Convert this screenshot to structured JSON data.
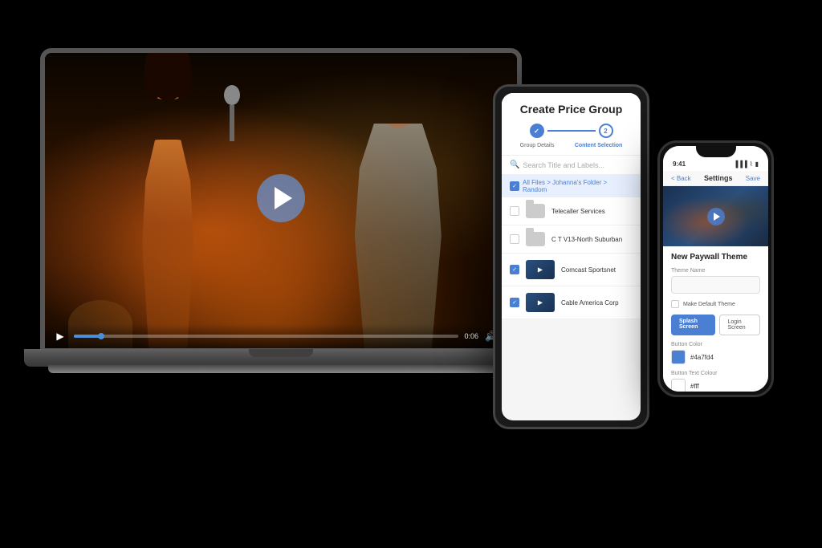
{
  "background": "#000000",
  "laptop": {
    "video": {
      "progress_percent": 8,
      "time_display": "0:06",
      "total_time": "0:06"
    }
  },
  "tablet": {
    "title": "Create Price Group",
    "steps": [
      {
        "number": "1",
        "label": "Group Details",
        "active": false
      },
      {
        "number": "2",
        "label": "Content Selection",
        "active": true
      }
    ],
    "search_placeholder": "Search Title and Labels...",
    "breadcrumb": "All Files > Johanna's Folder > Random",
    "files": [
      {
        "name": "Telecaller Services",
        "type": "folder",
        "checked": false
      },
      {
        "name": "C T V13-North Suburban",
        "type": "folder",
        "checked": false
      },
      {
        "name": "Comcast Sportsnet",
        "type": "video",
        "checked": true
      },
      {
        "name": "Cable America Corp",
        "type": "video",
        "checked": true
      }
    ]
  },
  "phone": {
    "status_time": "9:41",
    "status_icons": "●●●",
    "header_back": "< Back",
    "header_title": "Settings",
    "header_save": "Save",
    "video_section": "New Paywall Theme",
    "form": {
      "theme_name_label": "Theme Name",
      "theme_name_placeholder": "",
      "make_default_label": "Make Default Theme",
      "splash_screen_label": "Splash Screen",
      "login_screen_label": "Login Screen",
      "button_color_label": "Button Color",
      "button_color_value": "#4a7fd4",
      "button_text_color_label": "Button Text Colour",
      "button_text_color_value": "#fff"
    }
  }
}
